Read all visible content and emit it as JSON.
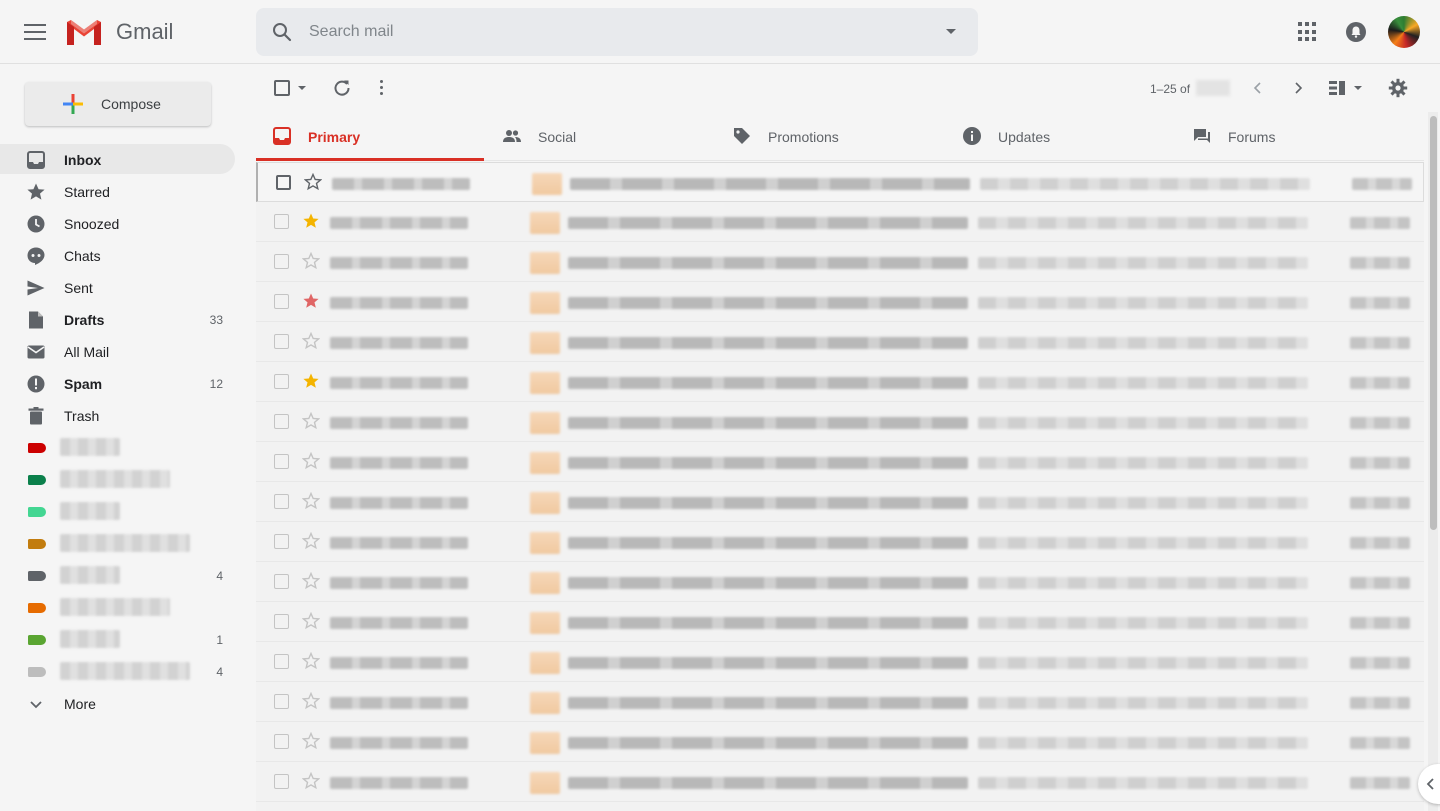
{
  "header": {
    "app_name": "Gmail",
    "search_placeholder": "Search mail",
    "icons": [
      "menu-icon",
      "gmail-logo",
      "search-icon",
      "search-options-icon",
      "apps-icon",
      "notifications-icon",
      "account-avatar"
    ]
  },
  "sidebar": {
    "compose_label": "Compose",
    "items": [
      {
        "label": "Inbox",
        "icon": "inbox-icon",
        "count": "",
        "bold": true,
        "active": true
      },
      {
        "label": "Starred",
        "icon": "star-icon",
        "count": "",
        "bold": false
      },
      {
        "label": "Snoozed",
        "icon": "clock-icon",
        "count": "",
        "bold": false
      },
      {
        "label": "Chats",
        "icon": "chat-icon",
        "count": "",
        "bold": false
      },
      {
        "label": "Sent",
        "icon": "send-icon",
        "count": "",
        "bold": false
      },
      {
        "label": "Drafts",
        "icon": "draft-icon",
        "count": "33",
        "bold": true
      },
      {
        "label": "All Mail",
        "icon": "mail-icon",
        "count": "",
        "bold": false
      },
      {
        "label": "Spam",
        "icon": "spam-icon",
        "count": "12",
        "bold": true
      },
      {
        "label": "Trash",
        "icon": "trash-icon",
        "count": "",
        "bold": false
      }
    ],
    "labels": [
      {
        "color": "#cc0000",
        "count": ""
      },
      {
        "color": "#0b804b",
        "count": ""
      },
      {
        "color": "#43d692",
        "count": ""
      },
      {
        "color": "#c27c0e",
        "count": ""
      },
      {
        "color": "#5f6368",
        "count": "4"
      },
      {
        "color": "#e66b00",
        "count": ""
      },
      {
        "color": "#5aa532",
        "count": "1"
      },
      {
        "color": "#bdbdbd",
        "count": "4"
      }
    ],
    "more_label": "More"
  },
  "toolbar": {
    "pager_text": "1–25 of",
    "icons": [
      "select-all-checkbox",
      "select-dropdown-icon",
      "refresh-icon",
      "more-vert-icon",
      "prev-page-icon",
      "next-page-icon",
      "split-pane-icon",
      "settings-icon"
    ]
  },
  "tabs": [
    {
      "label": "Primary",
      "icon": "inbox-tab-icon",
      "active": true
    },
    {
      "label": "Social",
      "icon": "people-icon",
      "active": false
    },
    {
      "label": "Promotions",
      "icon": "tag-icon",
      "active": false
    },
    {
      "label": "Updates",
      "icon": "info-icon",
      "active": false
    },
    {
      "label": "Forums",
      "icon": "forum-icon",
      "active": false
    }
  ],
  "emails": {
    "stars": [
      "none",
      "yellow",
      "none",
      "red",
      "none",
      "yellow",
      "none",
      "none",
      "none",
      "none",
      "none",
      "none",
      "none",
      "none",
      "none",
      "none"
    ],
    "colors": {
      "yellow_star": "#f4b400",
      "red_star": "#e06666",
      "empty_star": "#c4c4c4"
    }
  },
  "colors": {
    "accent": "#d93025",
    "background": "#f5f5f5"
  }
}
